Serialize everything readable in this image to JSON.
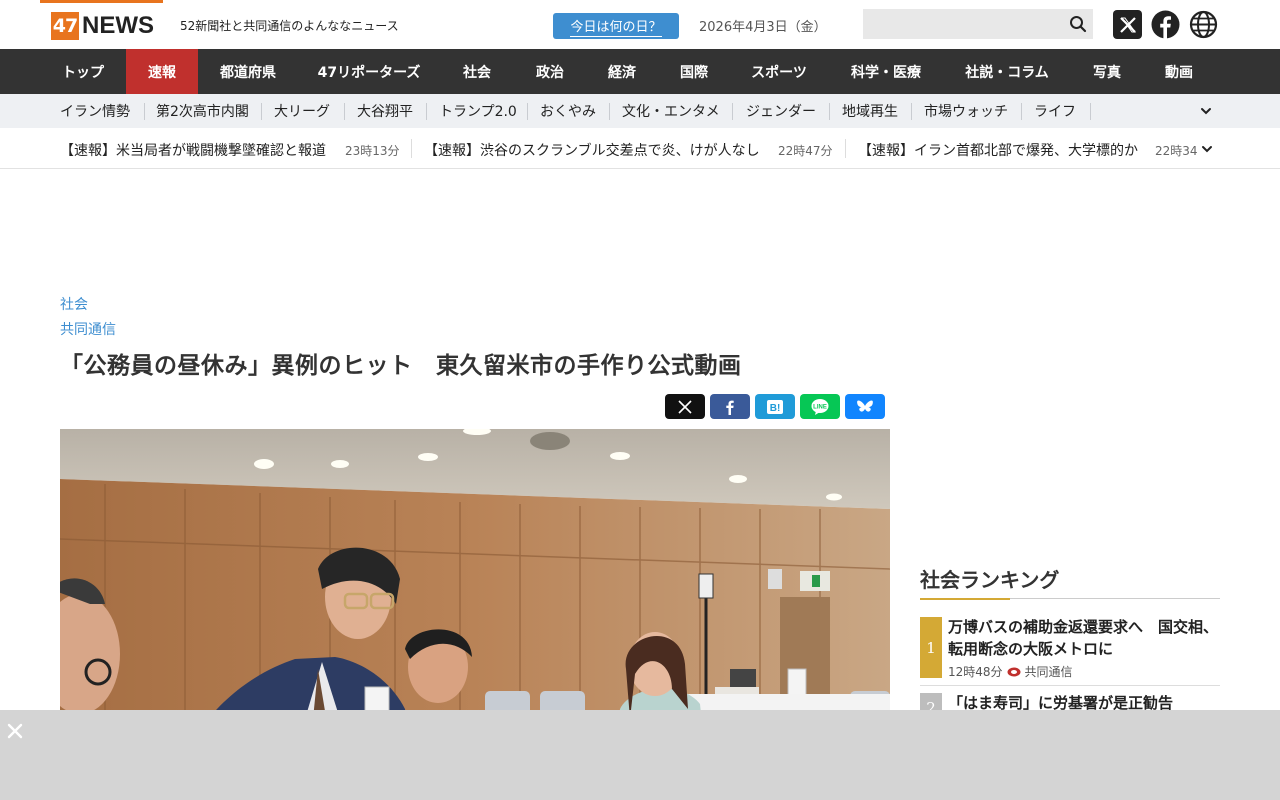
{
  "header": {
    "logo_num": "47",
    "logo_text": "NEWS",
    "tagline": "52新聞社と共同通信のよんななニュース",
    "today_button": "今日は何の日？",
    "date": "2026年4月3日（金）",
    "search_placeholder": "",
    "accent_color": "#e8741e"
  },
  "main_nav": {
    "items": [
      "トップ",
      "速報",
      "都道府県",
      "47リポーターズ",
      "社会",
      "政治",
      "経済",
      "国際",
      "スポーツ",
      "科学・医療",
      "社説・コラム",
      "写真",
      "動画"
    ],
    "active": "速報",
    "active_color": "#c0302d"
  },
  "sub_nav": {
    "items": [
      "イラン情勢",
      "第2次高市内閣",
      "大リーグ",
      "大谷翔平",
      "トランプ2.0",
      "おくやみ",
      "文化・エンタメ",
      "ジェンダー",
      "地域再生",
      "市場ウォッチ",
      "ライフ"
    ]
  },
  "ticker": {
    "items": [
      {
        "text": "【速報】米当局者が戦闘機撃墜確認と報道",
        "time": "23時13分"
      },
      {
        "text": "【速報】渋谷のスクランブル交差点で炎、けが人なし",
        "time": "22時47分"
      },
      {
        "text": "【速報】イラン首都北部で爆発、大学標的か",
        "time": "22時34"
      }
    ]
  },
  "article": {
    "category": "社会",
    "source": "共同通信",
    "title": "「公務員の昼休み」異例のヒット　東久留米市の手作り公式動画",
    "share": [
      "x-share",
      "facebook-share",
      "hatena-share",
      "line-share",
      "bluesky-share"
    ]
  },
  "ranking": {
    "title": "社会ランキング",
    "items": [
      {
        "rank": "1",
        "text": "万博バスの補助金返還要求へ　国交相、転用断念の大阪メトロに",
        "time": "12時48分",
        "source": "共同通信"
      },
      {
        "rank": "2",
        "text": "「はま寿司」に労基署が是正勧告"
      }
    ]
  }
}
